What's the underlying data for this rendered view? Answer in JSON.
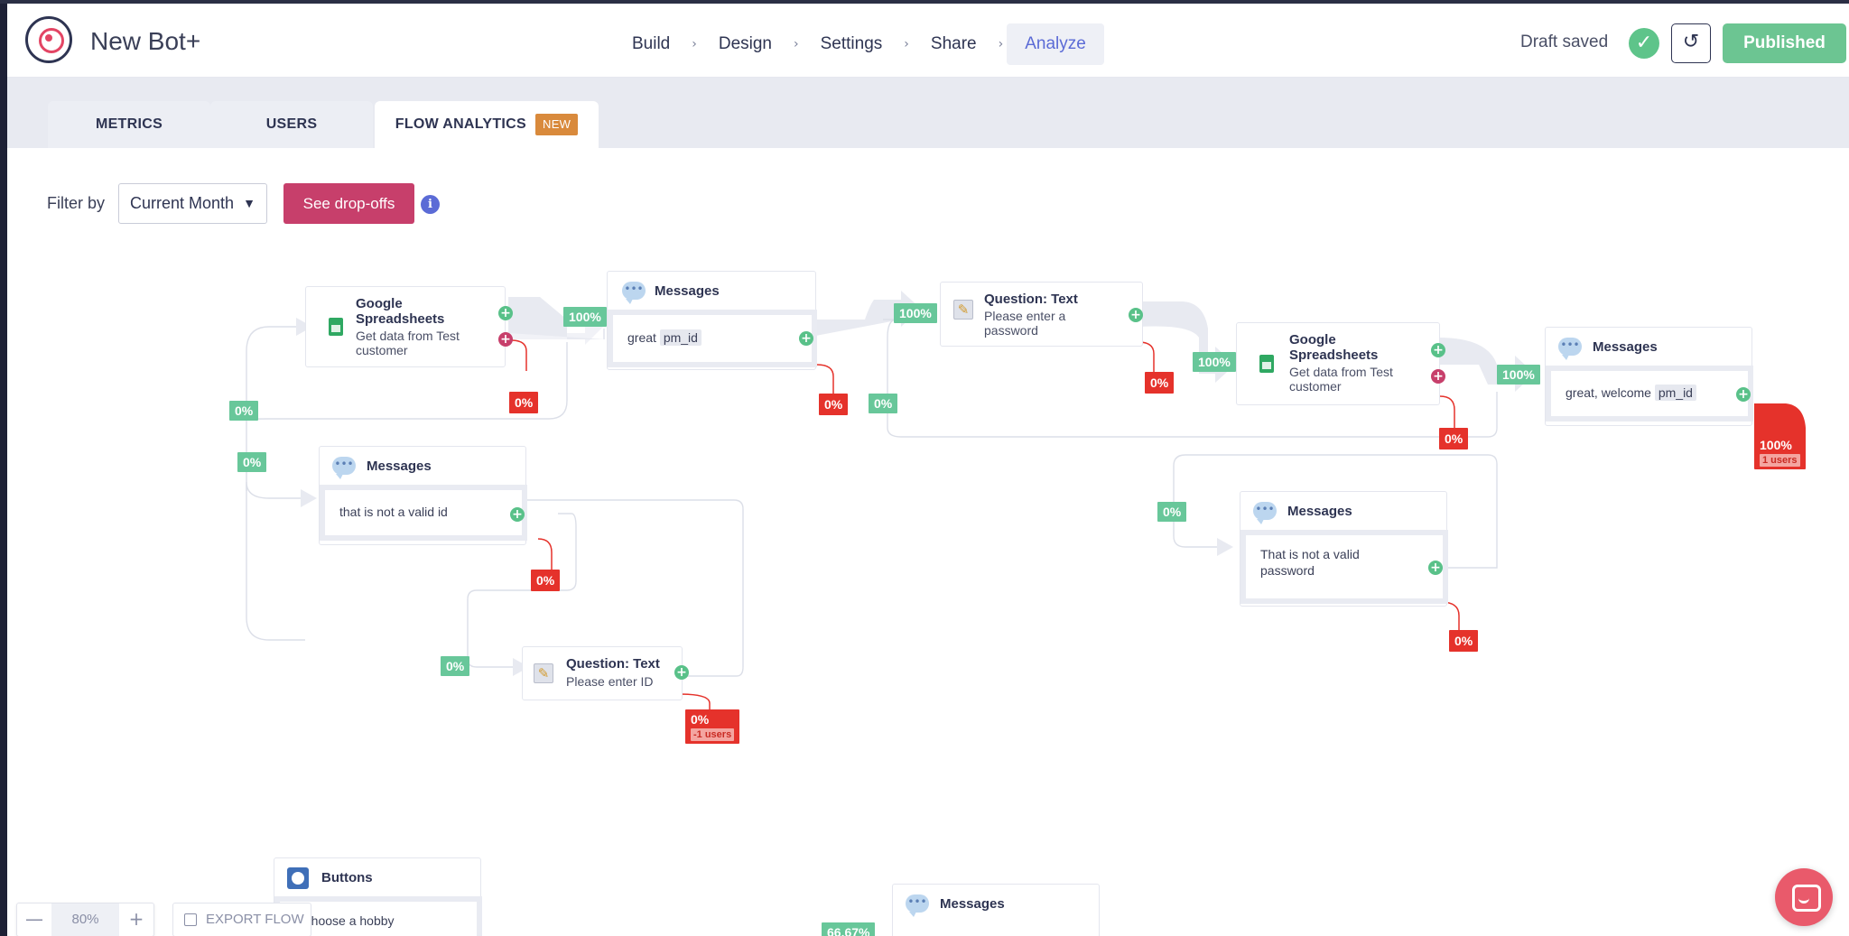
{
  "app": {
    "title": "New Bot+"
  },
  "nav": {
    "items": [
      "Build",
      "Design",
      "Settings",
      "Share",
      "Analyze"
    ],
    "active": "Analyze",
    "separator": "›"
  },
  "status": {
    "draft_text": "Draft saved",
    "publish_label": "Published"
  },
  "tabs": {
    "metrics": "METRICS",
    "users": "USERS",
    "flow_analytics": "FLOW ANALYTICS",
    "new_badge": "NEW"
  },
  "filter": {
    "label": "Filter by",
    "selected": "Current Month",
    "dropoffs_label": "See drop-offs",
    "info_glyph": "i"
  },
  "nodes": {
    "sheets1": {
      "title": "Google Spreadsheets",
      "sub": "Get data from Test customer"
    },
    "msg1": {
      "title": "Messages",
      "text": "great",
      "var": "pm_id"
    },
    "q1": {
      "title": "Question: Text",
      "sub": "Please enter a password"
    },
    "sheets2": {
      "title": "Google Spreadsheets",
      "sub": "Get data from Test customer"
    },
    "msg2": {
      "title": "Messages",
      "text": "great, welcome",
      "var": "pm_id"
    },
    "msg3": {
      "title": "Messages",
      "text": "that is not a valid id"
    },
    "q2": {
      "title": "Question: Text",
      "sub": "Please enter ID"
    },
    "msg4": {
      "title": "Messages",
      "text": "That is not a valid password"
    },
    "buttons": {
      "title": "Buttons",
      "text": "e choose a hobby"
    },
    "msg5": {
      "title": "Messages"
    }
  },
  "badges": {
    "g1": "0%",
    "g2": "0%",
    "g3": "100%",
    "g4": "100%",
    "g5": "0%",
    "g6": "100%",
    "g7": "100%",
    "g8": "0%",
    "g9": "0%",
    "g10": "66.67%",
    "r1": "0%",
    "r2": "0%",
    "r3": "0%",
    "r4": "0%",
    "r5": "0%",
    "r6": "0%",
    "r7": {
      "pct": "0%",
      "users": "-1 users"
    },
    "r8": {
      "pct": "100%",
      "users": "1 users"
    }
  },
  "zoom": {
    "minus": "—",
    "value": "80%",
    "plus": "+"
  },
  "export": {
    "label": "EXPORT FLOW"
  },
  "colors": {
    "accent": "#5b6bd6",
    "success": "#68c79a",
    "danger": "#e5322b",
    "brand": "#c73f6b"
  },
  "icons": [
    "logo-icon",
    "check-icon",
    "history-icon",
    "chevron-down-icon",
    "info-icon",
    "spreadsheet-icon",
    "chat-bubble-icon",
    "pencil-icon",
    "buttons-icon",
    "plus-icon",
    "export-icon",
    "chat-launcher-icon"
  ]
}
